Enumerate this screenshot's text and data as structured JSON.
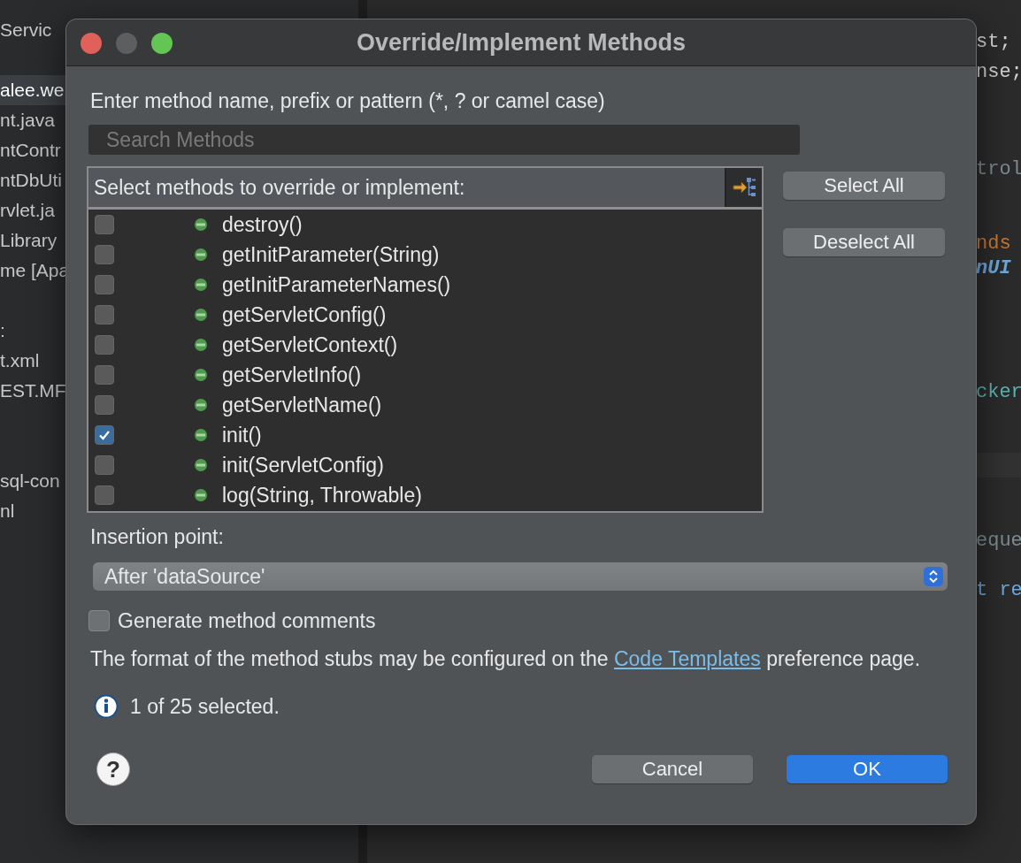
{
  "sidebar": {
    "header": [
      "Servic"
    ],
    "groups": [
      [
        {
          "label": "alee.we",
          "selected": true
        },
        {
          "label": "nt.java",
          "selected": false
        },
        {
          "label": "ntContr",
          "selected": false
        },
        {
          "label": "ntDbUti",
          "selected": false
        },
        {
          "label": "rvlet.ja",
          "selected": false
        },
        {
          "label": "Library",
          "selected": false
        },
        {
          "label": "me [Apa",
          "selected": false
        }
      ],
      [
        {
          "label": ":",
          "selected": false
        },
        {
          "label": "t.xml",
          "selected": false
        },
        {
          "label": "EST.MF",
          "selected": false
        }
      ],
      [
        {
          "label": "sql-con",
          "selected": false
        },
        {
          "label": "nl",
          "selected": false
        }
      ]
    ]
  },
  "editor": {
    "fragments": [
      {
        "text": "st;",
        "kind": "plain"
      },
      {
        "text": "nse;",
        "kind": "plain"
      },
      {
        "text": "trol",
        "kind": "comment"
      },
      {
        "text": "nds",
        "kind": "keyword"
      },
      {
        "text": "nUI",
        "kind": "field"
      },
      {
        "text": "cker",
        "kind": "string"
      },
      {
        "text": "eque",
        "kind": "comment"
      },
      {
        "text": "t re",
        "kind": "type"
      }
    ]
  },
  "dialog": {
    "title": "Override/Implement Methods",
    "filter_label": "Enter method name, prefix or pattern (*, ? or camel case)",
    "search": {
      "placeholder": "Search Methods"
    },
    "list_header": "Select methods to override or implement:",
    "methods": [
      {
        "name": "destroy()",
        "checked": false
      },
      {
        "name": "getInitParameter(String)",
        "checked": false
      },
      {
        "name": "getInitParameterNames()",
        "checked": false
      },
      {
        "name": "getServletConfig()",
        "checked": false
      },
      {
        "name": "getServletContext()",
        "checked": false
      },
      {
        "name": "getServletInfo()",
        "checked": false
      },
      {
        "name": "getServletName()",
        "checked": false
      },
      {
        "name": "init()",
        "checked": true
      },
      {
        "name": "init(ServletConfig)",
        "checked": false
      },
      {
        "name": "log(String, Throwable)",
        "checked": false
      }
    ],
    "side_buttons": [
      "Select All",
      "Deselect All"
    ],
    "insertion_label": "Insertion point:",
    "insertion_value": "After 'dataSource'",
    "generate_comments": {
      "label": "Generate method comments",
      "checked": false
    },
    "note": {
      "before": "The format of the method stubs may be configured on the ",
      "link": "Code Templates",
      "after": " preference page."
    },
    "status": "1 of 25 selected.",
    "help": "?",
    "buttons": [
      {
        "label": "Cancel",
        "kind": "secondary"
      },
      {
        "label": "OK",
        "kind": "primary"
      }
    ]
  }
}
